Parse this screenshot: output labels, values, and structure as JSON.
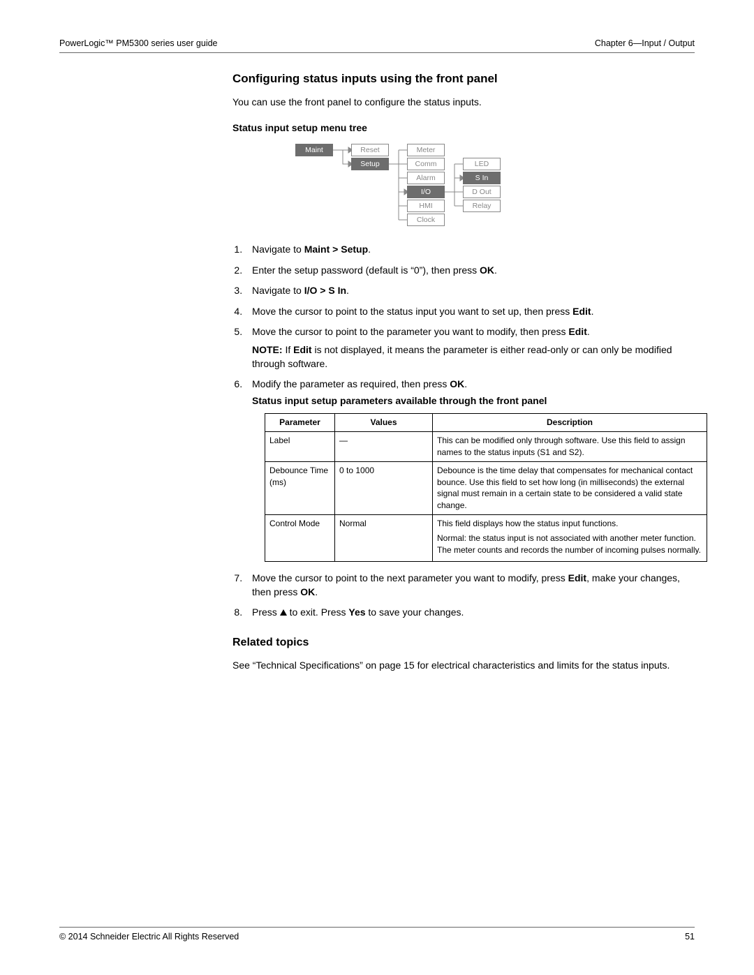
{
  "header": {
    "left": "PowerLogic™ PM5300 series user guide",
    "right": "Chapter 6—Input / Output"
  },
  "section": {
    "title": "Configuring status inputs using the front panel",
    "intro": "You can use the front panel to configure the status inputs.",
    "treeHeading": "Status input setup menu tree"
  },
  "tree": {
    "col1": [
      "Maint"
    ],
    "col2": [
      "Reset",
      "Setup"
    ],
    "col3": [
      "Meter",
      "Comm",
      "Alarm",
      "I/O",
      "HMI",
      "Clock"
    ],
    "col4": [
      "LED",
      "S In",
      "D Out",
      "Relay"
    ]
  },
  "steps": [
    {
      "pre": "Navigate to ",
      "bold": "Maint > Setup",
      "post": "."
    },
    {
      "pre": "Enter the setup password (default is “0”), then press ",
      "bold": "OK",
      "post": "."
    },
    {
      "pre": "Navigate to ",
      "bold": "I/O > S In",
      "post": "."
    },
    {
      "pre": "Move the cursor to point to the status input you want to set up, then press ",
      "bold": "Edit",
      "post": "."
    },
    {
      "pre": "Move the cursor to point to the parameter you want to modify, then press ",
      "bold": "Edit",
      "post": "."
    }
  ],
  "note": {
    "label": "NOTE:",
    "pre": " If ",
    "bold": "Edit",
    "post": " is not displayed, it means the parameter is either read-only or can only be modified through software."
  },
  "step6": {
    "pre": "Modify the parameter as required, then press ",
    "bold": "OK",
    "post": "."
  },
  "tableHeading": "Status input setup parameters available through the front panel",
  "table": {
    "headers": [
      "Parameter",
      "Values",
      "Description"
    ],
    "rows": [
      {
        "param": "Label",
        "values": "—",
        "desc": "This can be modified only through software. Use this field to assign names to the status inputs (S1 and S2)."
      },
      {
        "param": "Debounce Time (ms)",
        "values": "0 to 1000",
        "desc": "Debounce is the time delay that compensates for mechanical contact bounce. Use this field to set how long (in milliseconds) the external signal must remain in a certain state to be considered a valid state change."
      },
      {
        "param": "Control Mode",
        "values": "Normal",
        "descLines": [
          "This field displays how the status input functions.",
          "Normal: the status input is not associated with another meter function. The meter counts and records the number of incoming pulses normally."
        ]
      }
    ]
  },
  "step7": {
    "pre": "Move the cursor to point to the next parameter you want to modify, press ",
    "bold1": "Edit",
    "mid": ", make your changes, then press ",
    "bold2": "OK",
    "post": "."
  },
  "step8": {
    "pre": "Press ",
    "mid": " to exit. Press ",
    "bold": "Yes",
    "post": " to save your changes."
  },
  "related": {
    "heading": "Related topics",
    "text": "See “Technical Specifications” on page 15 for electrical characteristics and limits for the status inputs."
  },
  "footer": {
    "left": "© 2014 Schneider Electric All Rights Reserved",
    "right": "51"
  }
}
